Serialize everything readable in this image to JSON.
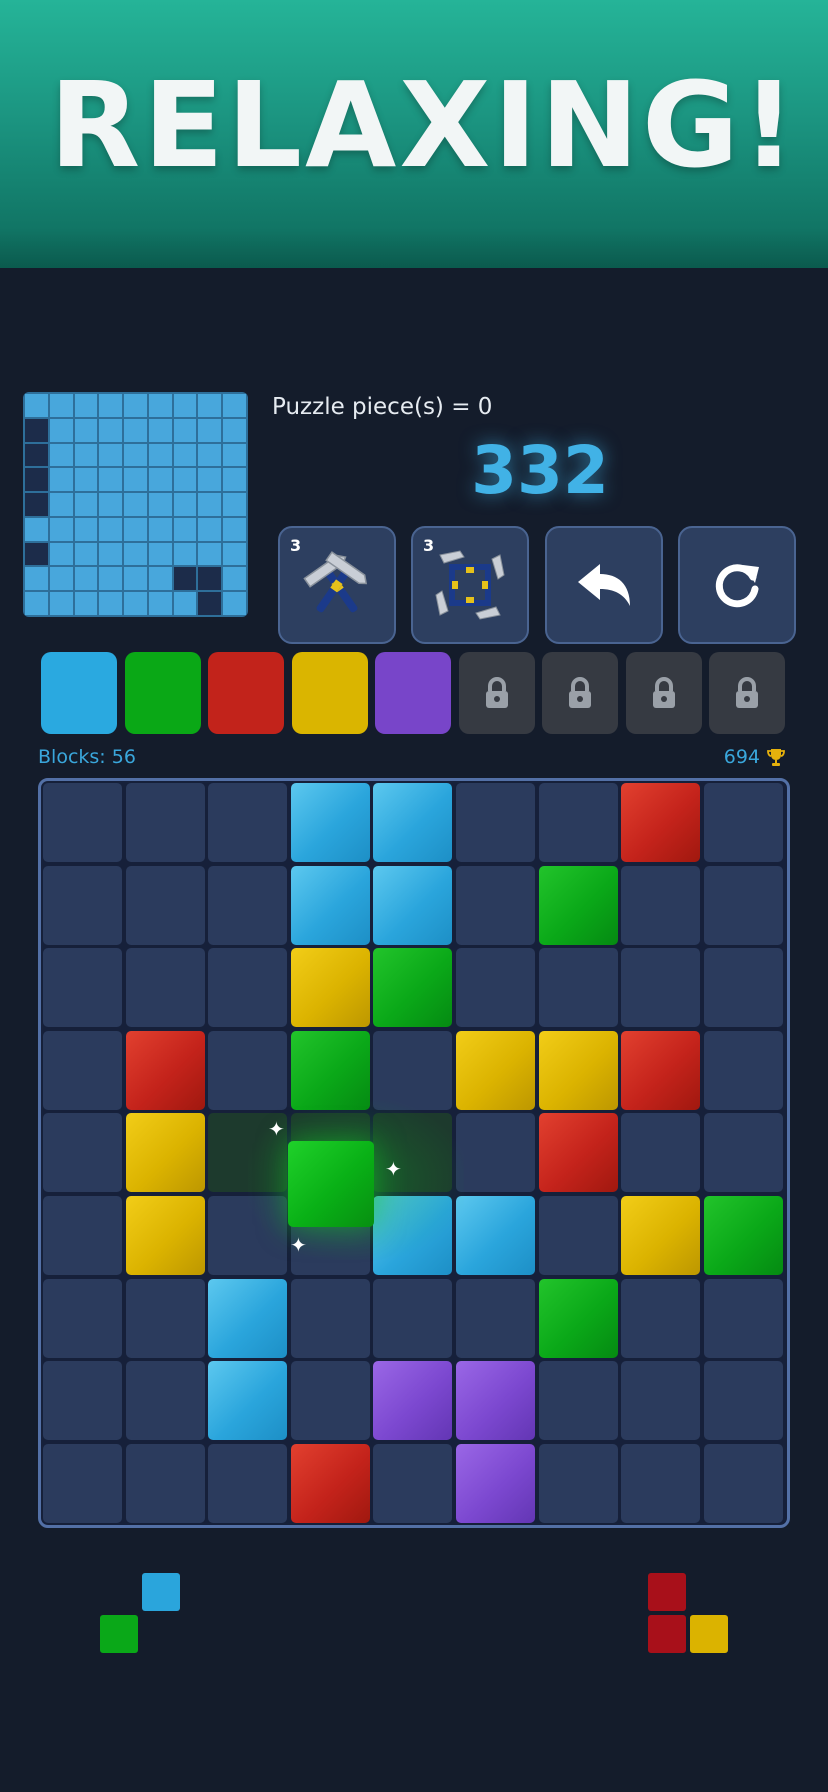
{
  "banner": {
    "title": "RELAXING!"
  },
  "minimap": {
    "rows": [
      [
        0,
        0,
        0,
        0,
        0,
        0,
        0,
        0,
        0
      ],
      [
        1,
        0,
        0,
        0,
        0,
        0,
        0,
        0,
        0
      ],
      [
        1,
        0,
        0,
        0,
        0,
        0,
        0,
        0,
        0
      ],
      [
        1,
        0,
        0,
        0,
        0,
        0,
        0,
        0,
        0
      ],
      [
        1,
        0,
        0,
        0,
        0,
        0,
        0,
        0,
        0
      ],
      [
        0,
        0,
        0,
        0,
        0,
        0,
        0,
        0,
        0
      ],
      [
        1,
        0,
        0,
        0,
        0,
        0,
        0,
        0,
        0
      ],
      [
        0,
        0,
        0,
        0,
        0,
        0,
        1,
        1,
        0
      ],
      [
        0,
        0,
        0,
        0,
        0,
        0,
        0,
        1,
        0
      ]
    ]
  },
  "puzzle_label": "Puzzle piece(s) = 0",
  "score": "332",
  "tools": [
    {
      "name": "hammer",
      "count": "3"
    },
    {
      "name": "multi-hammer",
      "count": "3"
    },
    {
      "name": "undo",
      "count": ""
    },
    {
      "name": "restart",
      "count": ""
    }
  ],
  "palette": [
    {
      "color": "#2aa9e0",
      "locked": false
    },
    {
      "color": "#0aa816",
      "locked": false
    },
    {
      "color": "#c2231b",
      "locked": false
    },
    {
      "color": "#dab500",
      "locked": false
    },
    {
      "color": "#7845c9",
      "locked": false
    },
    {
      "color": "#363a42",
      "locked": true
    },
    {
      "color": "#363a42",
      "locked": true
    },
    {
      "color": "#363a42",
      "locked": true
    },
    {
      "color": "#363a42",
      "locked": true
    }
  ],
  "blocks_label": "Blocks: 56",
  "best_score": "694",
  "board": [
    [
      "e",
      "e",
      "e",
      "b",
      "b",
      "e",
      "e",
      "r",
      "e"
    ],
    [
      "e",
      "e",
      "e",
      "b",
      "b",
      "e",
      "g",
      "e",
      "e"
    ],
    [
      "e",
      "e",
      "e",
      "y",
      "g",
      "e",
      "e",
      "e",
      "e"
    ],
    [
      "e",
      "r",
      "e",
      "g",
      "e",
      "y",
      "y",
      "r",
      "e"
    ],
    [
      "e",
      "y",
      "x",
      "x",
      "x",
      "e",
      "r",
      "e",
      "e"
    ],
    [
      "e",
      "y",
      "e",
      "e",
      "b",
      "b",
      "e",
      "y",
      "g"
    ],
    [
      "e",
      "e",
      "b",
      "e",
      "e",
      "e",
      "g",
      "e",
      "e"
    ],
    [
      "e",
      "e",
      "b",
      "e",
      "p",
      "p",
      "e",
      "e",
      "e"
    ],
    [
      "e",
      "e",
      "e",
      "r",
      "e",
      "p",
      "e",
      "e",
      "e"
    ]
  ],
  "colors": {
    "empty": "#2b3b5d",
    "blue": "#2aa5dc",
    "green": "#0aa818",
    "red": "#c4231b",
    "yellow": "#dbb300",
    "purple": "#7c48d0",
    "accent": "#3aa7dc"
  },
  "next_pieces": [
    {
      "blocks": [
        {
          "c": 1,
          "r": 0,
          "color": "#2aa5dc"
        },
        {
          "c": 0,
          "r": 1,
          "color": "#0aa818"
        }
      ]
    },
    {
      "blocks": [
        {
          "c": 0,
          "r": 0,
          "color": "#a8101a"
        },
        {
          "c": 0,
          "r": 1,
          "color": "#a8101a"
        },
        {
          "c": 1,
          "r": 1,
          "color": "#dbb300"
        }
      ]
    }
  ]
}
